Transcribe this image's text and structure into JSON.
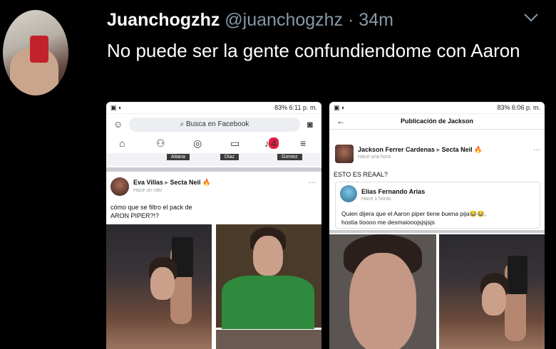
{
  "tweet": {
    "display_name": "Juanchogzhz",
    "handle": "@juanchogzhz",
    "separator": "·",
    "time": "34m",
    "text": "No puede ser la gente confundiendome con Aaron"
  },
  "screenshot_left": {
    "status_time": "6:11 p. m.",
    "status_battery": "83%",
    "search_placeholder": "Busca en Facebook",
    "notification_count": "4",
    "stories": [
      "Aitana",
      "Diaz",
      "Gomez"
    ],
    "post": {
      "author": "Eva Villas",
      "arrow": "▸",
      "group": "Secta Neil 🔥",
      "meta": "Hace un rato",
      "text_line1": "cómo que se filtro el pack de",
      "text_line2": "ARON PIPER?!?"
    }
  },
  "screenshot_right": {
    "status_time": "6:06 p. m.",
    "status_battery": "83%",
    "title": "Publicación de Jackson",
    "post": {
      "author": "Jackson Ferrer Cardenas",
      "arrow": "▸",
      "group": "Secta Neil 🔥",
      "meta": "Hace una hora",
      "text": "ESTO ES REAAL?"
    },
    "shared": {
      "author": "Elias Fernando Arias",
      "meta": "Hace 1 horas",
      "text_line1": "Quien dijera que  el Aaron piper tiene buena pija😂😂,",
      "text_line2": "hostia tioooo me desmaiooojsjsjsjs"
    }
  },
  "colors": {
    "background": "#000000",
    "name": "#ffffff",
    "secondary": "#8899a6",
    "fb_badge": "#e41e3f"
  }
}
